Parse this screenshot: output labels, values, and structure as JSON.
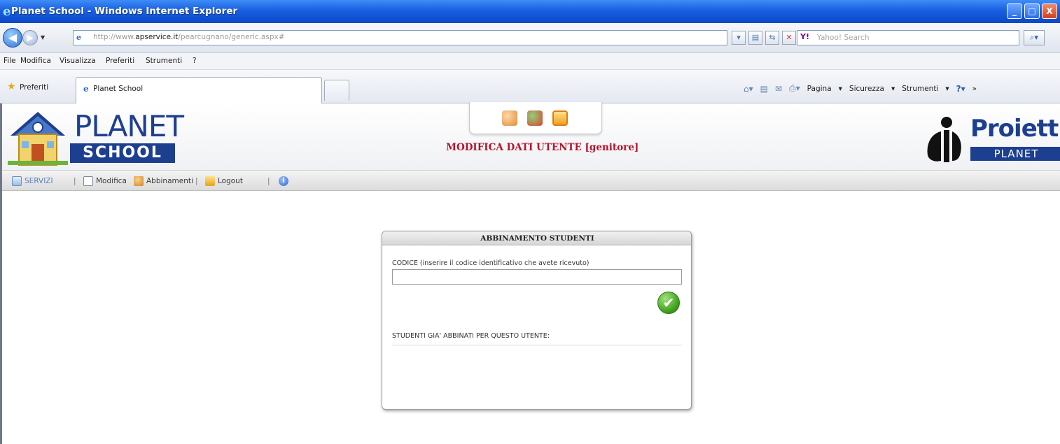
{
  "window": {
    "title": "Planet School - Windows Internet Explorer",
    "buttons": {
      "minimize": "_",
      "maximize": "□",
      "close": "X"
    }
  },
  "address_bar": {
    "url_prefix": "http://www.",
    "url_domain": "apservice.it",
    "url_suffix": "/pearcugnano/generic.aspx#",
    "search_placeholder": "Yahoo! Search",
    "search_brand": "Y!"
  },
  "menu": [
    "File",
    "Modifica",
    "Visualizza",
    "Preferiti",
    "Strumenti",
    "?"
  ],
  "favorites_bar": {
    "favorites_label": "Preferiti",
    "tab_label": "Planet School",
    "commands": [
      "Pagina",
      "Sicurezza",
      "Strumenti"
    ]
  },
  "header": {
    "logo_planet": "PLANET",
    "logo_school": "SCHOOL",
    "page_title": "MODIFICA DATI UTENTE [genitore]",
    "brand_name": "Proietti",
    "brand_sub": "PLANET"
  },
  "toolbar": {
    "services": "SERVIZI",
    "edit": "Modifica",
    "links": "Abbinamenti",
    "logout": "Logout"
  },
  "panel": {
    "title": "ABBINAMENTO STUDENTI",
    "code_label": "CODICE (inserire il codice identificativo che avete ricevuto)",
    "code_value": "",
    "linked_label": "STUDENTI GIA' ABBINATI PER QUESTO UTENTE:"
  },
  "colors": {
    "title_bar": "#1a5fe0",
    "brand_blue": "#1d3f8f",
    "page_title_red": "#b3142b",
    "ok_green": "#3a9a1a"
  }
}
